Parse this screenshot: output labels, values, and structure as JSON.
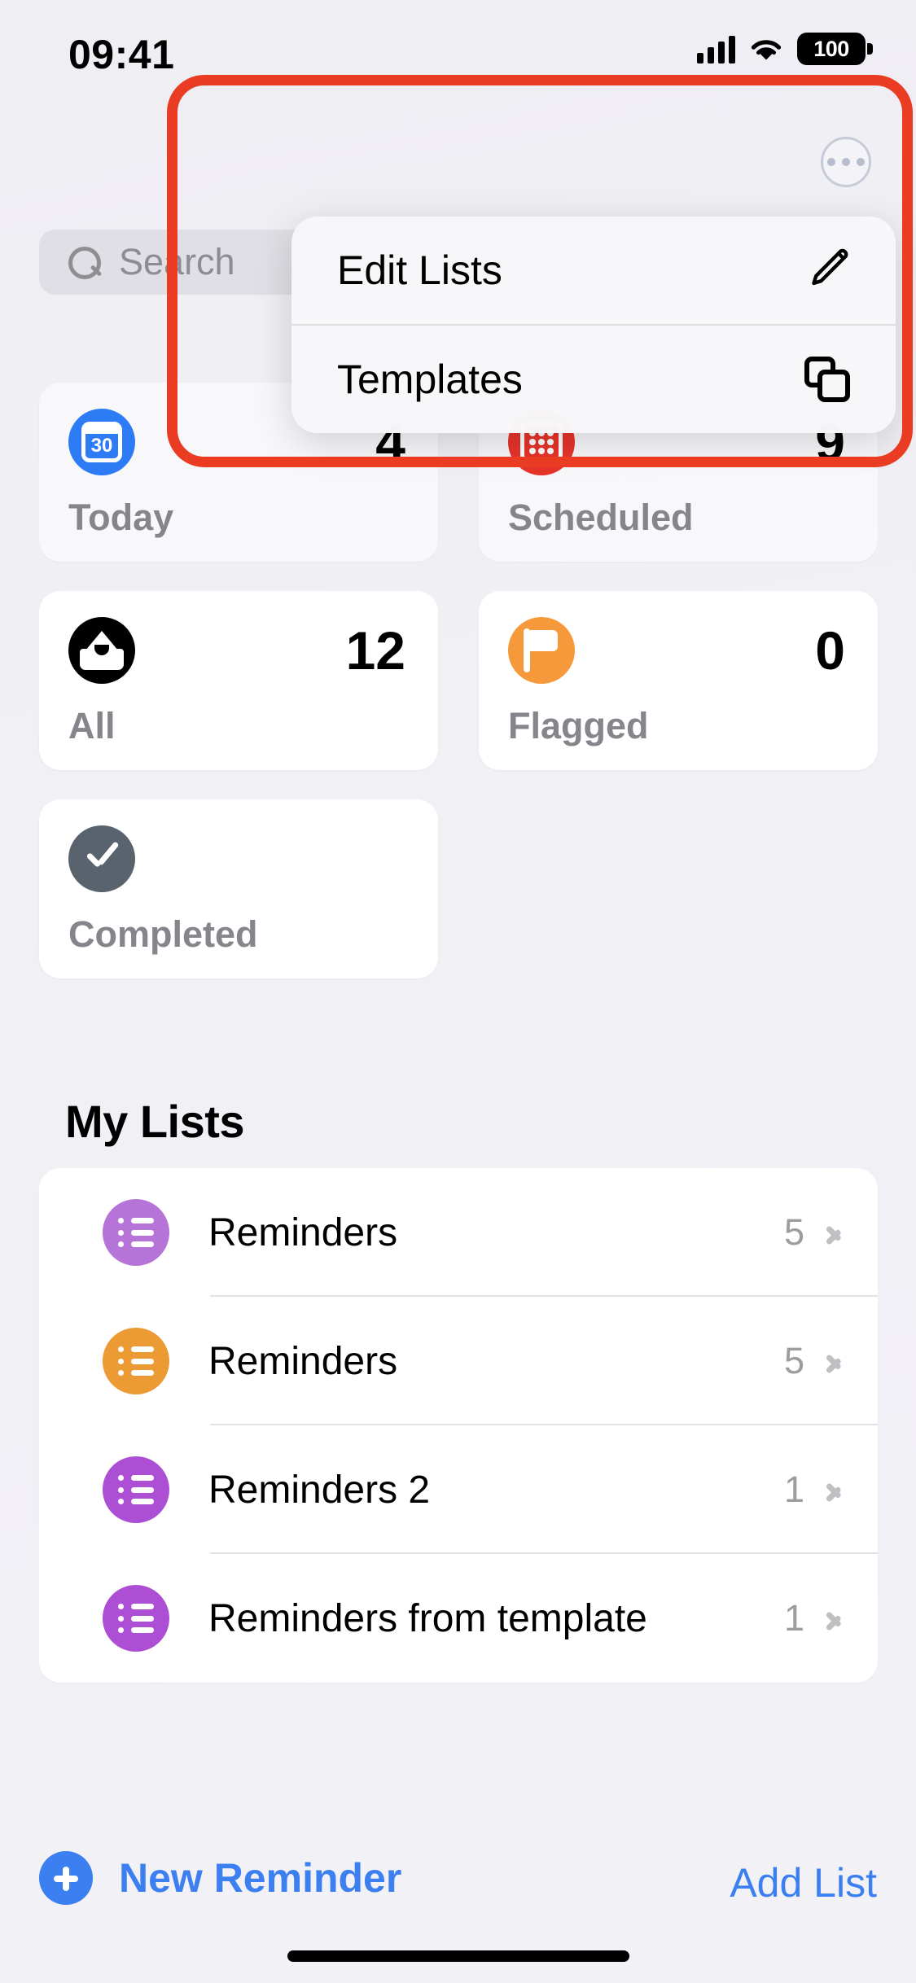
{
  "status_bar": {
    "time": "09:41",
    "battery_percent": "100",
    "cellular_icon": "cellular-bars-icon",
    "wifi_icon": "wifi-icon",
    "battery_icon": "battery-icon"
  },
  "header": {
    "more_button_icon": "ellipsis-circle-icon"
  },
  "search": {
    "placeholder": "Search",
    "icon": "search-icon",
    "value": ""
  },
  "smart_lists": [
    {
      "label": "Today",
      "count": "4",
      "icon": "calendar-30-icon",
      "color": "#2d7cf6"
    },
    {
      "label": "Scheduled",
      "count": "9",
      "icon": "calendar-grid-icon",
      "color": "#e8342a"
    },
    {
      "label": "All",
      "count": "12",
      "icon": "inbox-tray-icon",
      "color": "#000000"
    },
    {
      "label": "Flagged",
      "count": "0",
      "icon": "flag-icon",
      "color": "#f5993b"
    },
    {
      "label": "Completed",
      "count": "",
      "icon": "checkmark-icon",
      "color": "#59636e"
    }
  ],
  "my_lists": {
    "title": "My Lists",
    "rows": [
      {
        "name": "Reminders",
        "count": "5",
        "icon": "list-bullet-icon",
        "color": "#b674d8",
        "chevron": "chevron-right-icon"
      },
      {
        "name": "Reminders",
        "count": "5",
        "icon": "list-bullet-icon",
        "color": "#eb9a34",
        "chevron": "chevron-right-icon"
      },
      {
        "name": "Reminders 2",
        "count": "1",
        "icon": "list-bullet-icon",
        "color": "#ac4fd4",
        "chevron": "chevron-right-icon"
      },
      {
        "name": "Reminders from template",
        "count": "1",
        "icon": "list-bullet-icon",
        "color": "#ac4fd4",
        "chevron": "chevron-right-icon"
      }
    ]
  },
  "context_menu": {
    "items": [
      {
        "label": "Edit Lists",
        "icon": "pencil-icon"
      },
      {
        "label": "Templates",
        "icon": "duplicate-squares-icon"
      }
    ]
  },
  "toolbar": {
    "new_reminder_label": "New Reminder",
    "new_reminder_icon": "plus-circle-icon",
    "add_list_label": "Add List",
    "accent_color": "#3b7ff0"
  },
  "annotation": {
    "shape": "rounded-rectangle-highlight",
    "color": "#ea3c23"
  }
}
